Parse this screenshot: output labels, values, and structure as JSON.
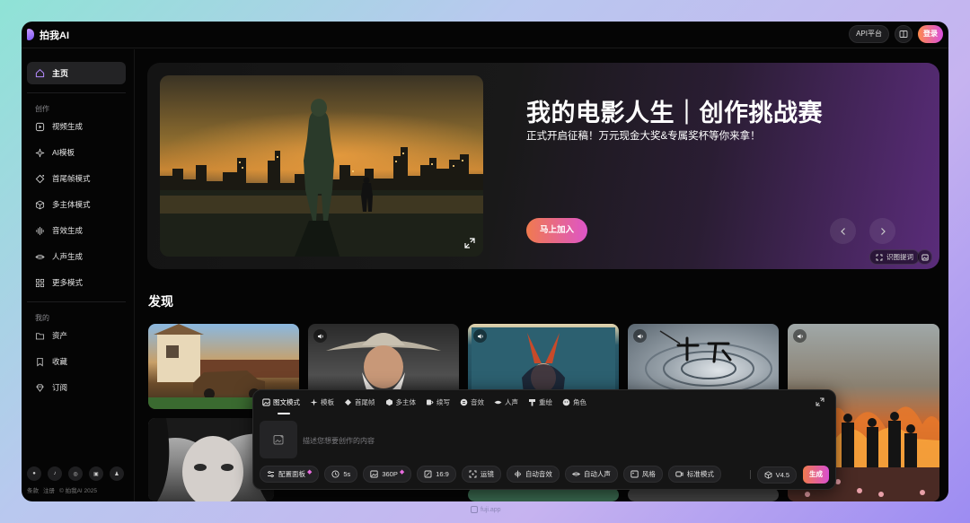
{
  "app": {
    "name": "拍我AI"
  },
  "header": {
    "api_label": "API平台",
    "login_label": "登录"
  },
  "sidebar": {
    "home": "主页",
    "create_label": "创作",
    "create_items": [
      "视频生成",
      "AI模板",
      "首尾帧模式",
      "多主体模式",
      "音效生成",
      "人声生成",
      "更多模式"
    ],
    "mine_label": "我的",
    "mine_items": [
      "资产",
      "收藏",
      "订阅"
    ],
    "footer": [
      "条款",
      "注册",
      "© 拍我AI 2025"
    ]
  },
  "banner": {
    "title": "我的电影人生｜创作挑战赛",
    "subtitle": "正式开启征稿！万元现金大奖&专属奖杯等你来拿！",
    "cta": "马上加入",
    "recognize": "识图提词"
  },
  "discover": {
    "title": "发现"
  },
  "composer": {
    "tabs": [
      "图文模式",
      "模板",
      "首尾帧",
      "多主体",
      "续写",
      "音效",
      "人声",
      "重绘",
      "角色"
    ],
    "placeholder": "描述您想要创作的内容",
    "tools": [
      "配置面板",
      "5s",
      "360P",
      "16:9",
      "运镜",
      "自动音效",
      "自动人声",
      "风格",
      "标准模式"
    ],
    "version": "V4.5",
    "generate": "生成"
  },
  "caption": "fuji.app",
  "colors": {
    "accent_start": "#f07a4e",
    "accent_end": "#d84fd0"
  }
}
